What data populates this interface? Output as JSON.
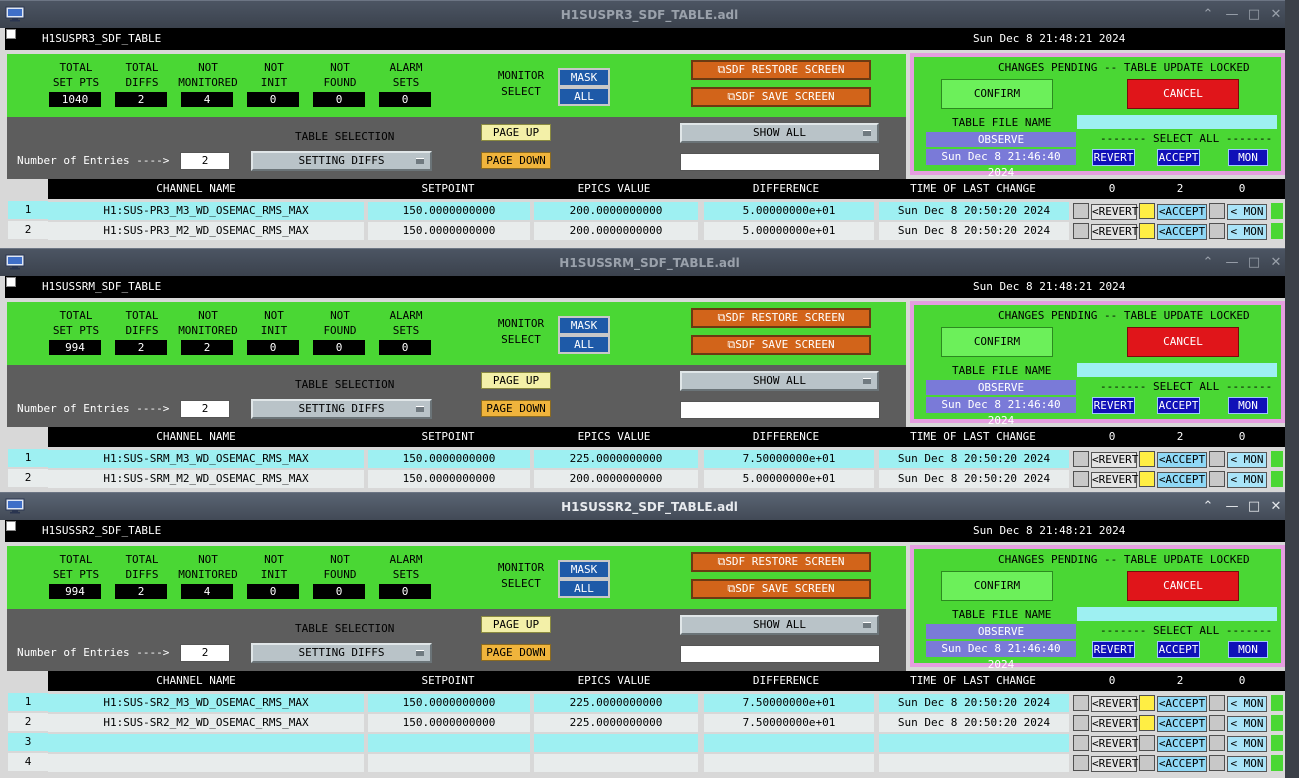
{
  "windows": [
    {
      "title": "H1SUSPR3_SDF_TABLE.adl",
      "active": false,
      "panel_name": "H1SUSPR3_SDF_TABLE",
      "current_time": "Sun Dec  8 21:48:21 2024",
      "stats": {
        "total_set_pts": "1040",
        "total_diffs": "2",
        "not_monitored": "4",
        "not_init": "0",
        "not_found": "0",
        "alarm_sets": "0"
      },
      "entries": "2",
      "table_file_name": "",
      "observe": "OBSERVE",
      "file_time": "Sun Dec  8 21:46:40 2024",
      "counts": {
        "revert": "0",
        "accept": "2",
        "mon": "0"
      },
      "rows": [
        {
          "num": "1",
          "channel": "H1:SUS-PR3_M3_WD_OSEMAC_RMS_MAX",
          "setpoint": "150.0000000000",
          "epics": "200.0000000000",
          "diff": "5.00000000e+01",
          "time": "Sun Dec  8 20:50:20 2024",
          "accept_on": true
        },
        {
          "num": "2",
          "channel": "H1:SUS-PR3_M2_WD_OSEMAC_RMS_MAX",
          "setpoint": "150.0000000000",
          "epics": "200.0000000000",
          "diff": "5.00000000e+01",
          "time": "Sun Dec  8 20:50:20 2024",
          "accept_on": true
        }
      ]
    },
    {
      "title": "H1SUSSRM_SDF_TABLE.adl",
      "active": false,
      "panel_name": "H1SUSSRM_SDF_TABLE",
      "current_time": "Sun Dec  8 21:48:21 2024",
      "stats": {
        "total_set_pts": "994",
        "total_diffs": "2",
        "not_monitored": "2",
        "not_init": "0",
        "not_found": "0",
        "alarm_sets": "0"
      },
      "entries": "2",
      "table_file_name": "",
      "observe": "OBSERVE",
      "file_time": "Sun Dec  8 21:46:40 2024",
      "counts": {
        "revert": "0",
        "accept": "2",
        "mon": "0"
      },
      "rows": [
        {
          "num": "1",
          "channel": "H1:SUS-SRM_M3_WD_OSEMAC_RMS_MAX",
          "setpoint": "150.0000000000",
          "epics": "225.0000000000",
          "diff": "7.50000000e+01",
          "time": "Sun Dec  8 20:50:20 2024",
          "accept_on": true
        },
        {
          "num": "2",
          "channel": "H1:SUS-SRM_M2_WD_OSEMAC_RMS_MAX",
          "setpoint": "150.0000000000",
          "epics": "200.0000000000",
          "diff": "5.00000000e+01",
          "time": "Sun Dec  8 20:50:20 2024",
          "accept_on": true
        }
      ]
    },
    {
      "title": "H1SUSSR2_SDF_TABLE.adl",
      "active": true,
      "panel_name": "H1SUSSR2_SDF_TABLE",
      "current_time": "Sun Dec  8 21:48:21 2024",
      "stats": {
        "total_set_pts": "994",
        "total_diffs": "2",
        "not_monitored": "4",
        "not_init": "0",
        "not_found": "0",
        "alarm_sets": "0"
      },
      "entries": "2",
      "table_file_name": "",
      "observe": "OBSERVE",
      "file_time": "Sun Dec  8 21:46:40 2024",
      "counts": {
        "revert": "0",
        "accept": "2",
        "mon": "0"
      },
      "rows": [
        {
          "num": "1",
          "channel": "H1:SUS-SR2_M3_WD_OSEMAC_RMS_MAX",
          "setpoint": "150.0000000000",
          "epics": "225.0000000000",
          "diff": "7.50000000e+01",
          "time": "Sun Dec  8 20:50:20 2024",
          "accept_on": true
        },
        {
          "num": "2",
          "channel": "H1:SUS-SR2_M2_WD_OSEMAC_RMS_MAX",
          "setpoint": "150.0000000000",
          "epics": "225.0000000000",
          "diff": "7.50000000e+01",
          "time": "Sun Dec  8 20:50:20 2024",
          "accept_on": true
        },
        {
          "num": "3",
          "channel": "",
          "setpoint": "",
          "epics": "",
          "diff": "",
          "time": "",
          "accept_on": false
        },
        {
          "num": "4",
          "channel": "",
          "setpoint": "",
          "epics": "",
          "diff": "",
          "time": "",
          "accept_on": false
        }
      ]
    }
  ],
  "labels": {
    "total": "TOTAL",
    "set_pts": "SET PTS",
    "diffs": "DIFFS",
    "not": "NOT",
    "monitored": "MONITORED",
    "init": "INIT",
    "found": "FOUND",
    "alarm": "ALARM",
    "sets": "SETS",
    "monitor": "MONITOR",
    "select": "SELECT",
    "mask": "MASK",
    "all": "ALL",
    "restore_screen": "SDF RESTORE SCREEN",
    "save_screen": "SDF SAVE SCREEN",
    "table_selection": "TABLE SELECTION",
    "page_up": "PAGE UP",
    "page_down": "PAGE DOWN",
    "show_all": "SHOW ALL",
    "number_of_entries": "Number of Entries ---->",
    "setting_diffs": "SETTING DIFFS",
    "changes_pending": "CHANGES PENDING -- TABLE UPDATE LOCKED",
    "confirm": "CONFIRM",
    "cancel": "CANCEL",
    "table_file_name": "TABLE FILE NAME",
    "select_all": "------- SELECT ALL -------",
    "revert": "REVERT",
    "accept": "ACCEPT",
    "mon": "MON",
    "row_revert": "<REVERT",
    "row_accept": "<ACCEPT",
    "row_mon": "< MON",
    "col_channel": "CHANNEL NAME",
    "col_setpoint": "SETPOINT",
    "col_epics": "EPICS VALUE",
    "col_diff": "DIFFERENCE",
    "col_time": "TIME OF LAST CHANGE"
  },
  "colors": {
    "panel_green": "#4ad734",
    "row_cyan": "#9ef0f2",
    "row_light": "#e8ecec",
    "accept_yellow": "#ffee44"
  }
}
